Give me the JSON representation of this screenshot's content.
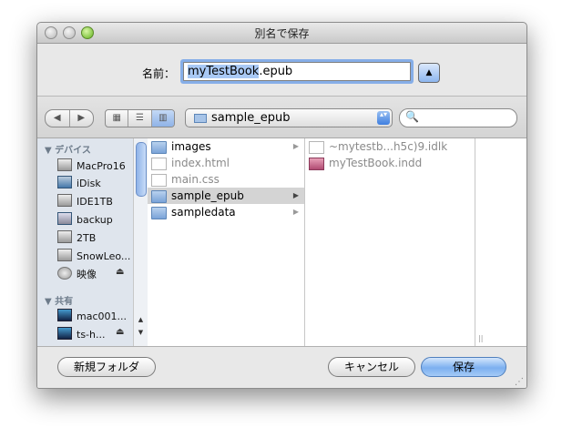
{
  "window": {
    "title": "別名で保存"
  },
  "save_as": {
    "label": "名前：",
    "filename_selected": "myTestBook",
    "filename_ext": ".epub",
    "expand_glyph": "▲"
  },
  "toolbar": {
    "back_glyph": "◀",
    "forward_glyph": "▶",
    "view_icons_glyph": "▦",
    "view_list_glyph": "☰",
    "view_columns_glyph": "▥",
    "location": "sample_epub",
    "popup_glyph": "▴▾",
    "search_glyph": "🔍",
    "search_value": ""
  },
  "sidebar": {
    "devices_header": "▼ デバイス",
    "shared_header": "▼ 共有",
    "devices": [
      {
        "label": "MacPro16",
        "icon": "hard-drive-icon"
      },
      {
        "label": "iDisk",
        "icon": "idisk-icon"
      },
      {
        "label": "IDE1TB",
        "icon": "hard-drive-icon"
      },
      {
        "label": "backup",
        "icon": "external-drive-icon"
      },
      {
        "label": "2TB",
        "icon": "hard-drive-icon"
      },
      {
        "label": "SnowLeo...",
        "icon": "hard-drive-icon"
      },
      {
        "label": "映像",
        "icon": "disc-icon",
        "eject": "⏏"
      }
    ],
    "shared": [
      {
        "label": "mac001...",
        "icon": "monitor-icon"
      },
      {
        "label": "ts-h...",
        "icon": "monitor-icon",
        "eject": "⏏"
      }
    ]
  },
  "columns": {
    "column1": [
      {
        "name": "images",
        "kind": "folder",
        "arrow": "▶",
        "dim": false
      },
      {
        "name": "index.html",
        "kind": "file",
        "arrow": "",
        "dim": true
      },
      {
        "name": "main.css",
        "kind": "file",
        "arrow": "",
        "dim": true
      },
      {
        "name": "sample_epub",
        "kind": "folder",
        "arrow": "▶",
        "dim": false,
        "selected": true
      },
      {
        "name": "sampledata",
        "kind": "folder",
        "arrow": "▶",
        "dim": false
      }
    ],
    "column2": [
      {
        "name": "~mytestb...h5c)9.idlk",
        "kind": "file"
      },
      {
        "name": "myTestBook.indd",
        "kind": "indesign-file"
      }
    ],
    "column_grip": "||"
  },
  "buttons": {
    "new_folder": "新規フォルダ",
    "cancel": "キャンセル",
    "save": "保存"
  },
  "colors": {
    "selection": "#a9c9f5",
    "primary_button": "#7cb0f0",
    "sidebar_bg": "#dfe5ed"
  }
}
